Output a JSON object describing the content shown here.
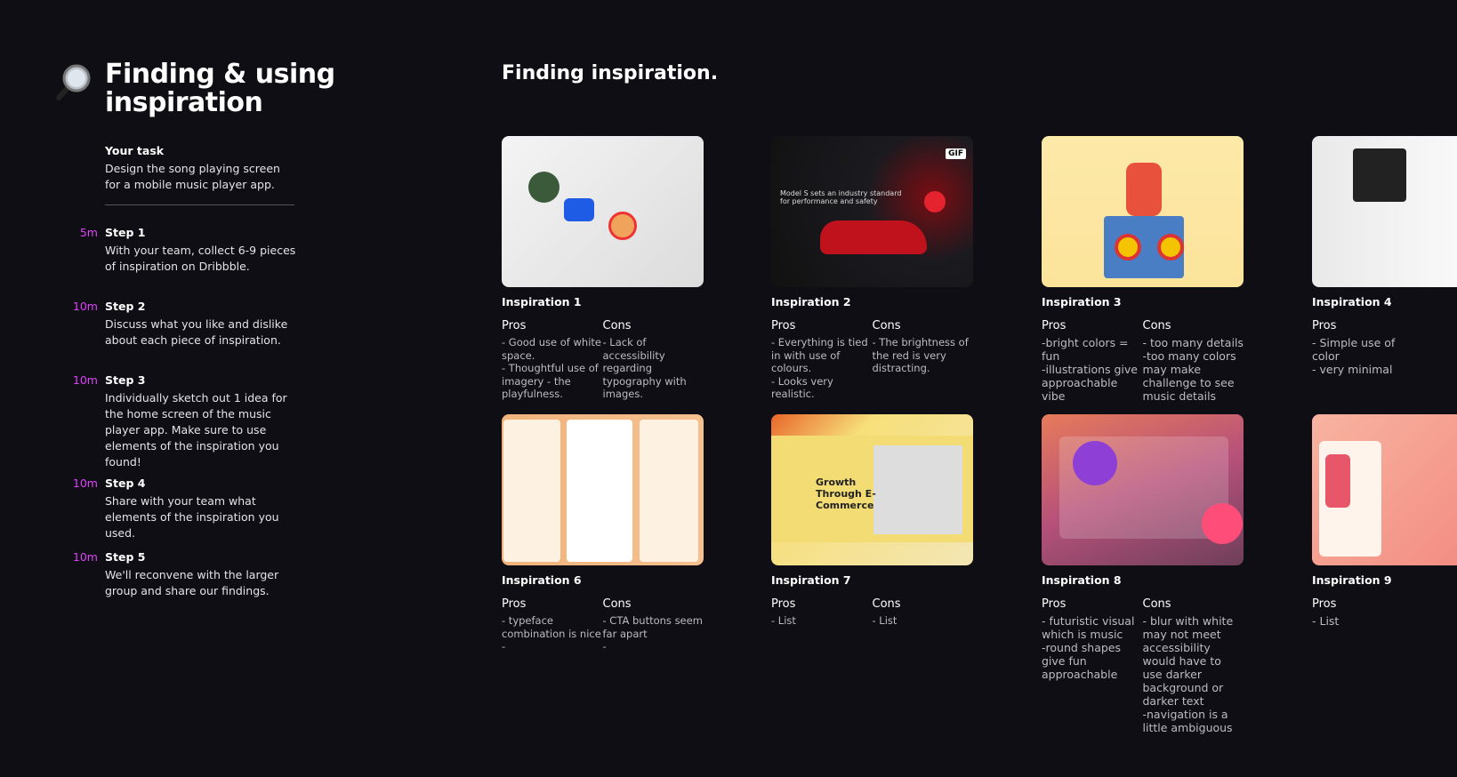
{
  "sidebar": {
    "icon": "magnifying-glass-icon",
    "title": "Finding & using inspiration",
    "task": {
      "label": "Your task",
      "text": "Design the song playing screen for a mobile music player app."
    },
    "steps": [
      {
        "time": "5m",
        "label": "Step 1",
        "text": "With your team, collect 6-9 pieces of inspiration on Dribbble."
      },
      {
        "time": "10m",
        "label": "Step 2",
        "text": "Discuss what you like and dislike about each piece of inspiration."
      },
      {
        "time": "10m",
        "label": "Step 3",
        "text": "Individually sketch out 1 idea for the home screen of the music player app. Make sure to use elements of the inspiration you found!"
      },
      {
        "time": "10m",
        "label": "Step 4",
        "text": "Share with your team what elements of the inspiration you used."
      },
      {
        "time": "10m",
        "label": "Step 5",
        "text": "We'll reconvene with the larger group and share our findings."
      }
    ]
  },
  "main": {
    "heading": "Finding inspiration.",
    "pros_label": "Pros",
    "cons_label": "Cons",
    "cards": [
      {
        "title": "Inspiration 1",
        "pros": "- Good use of white space.\n- Thoughtful use of imagery - the playfulness.",
        "cons": "- Lack of accessibility regarding typography with images."
      },
      {
        "title": "Inspiration 2",
        "badge": "GIF",
        "pros": "- Everything is tied in with use of colours.\n- Looks very realistic.",
        "cons": "- The brightness of the red is very distracting."
      },
      {
        "title": "Inspiration 3",
        "pros": "-bright colors = fun\n-illustrations give approachable vibe",
        "cons": "- too many details\n-too many colors may make challenge to see music details"
      },
      {
        "title": "Inspiration 4",
        "pros": "- Simple use of color\n- very minimal"
      },
      {
        "title": "Inspiration 6",
        "pros": "- typeface combination is nice\n-",
        "cons": "- CTA buttons seem far apart\n-"
      },
      {
        "title": "Inspiration 7",
        "pros": "- List",
        "cons": "- List"
      },
      {
        "title": "Inspiration 8",
        "pros": "- futuristic visual which is music\n-round shapes give fun approachable",
        "cons": "- blur with white may not meet accessibility would have to use darker background or darker text\n-navigation is a little ambiguous"
      },
      {
        "title": "Inspiration 9",
        "pros": "- List"
      }
    ]
  }
}
